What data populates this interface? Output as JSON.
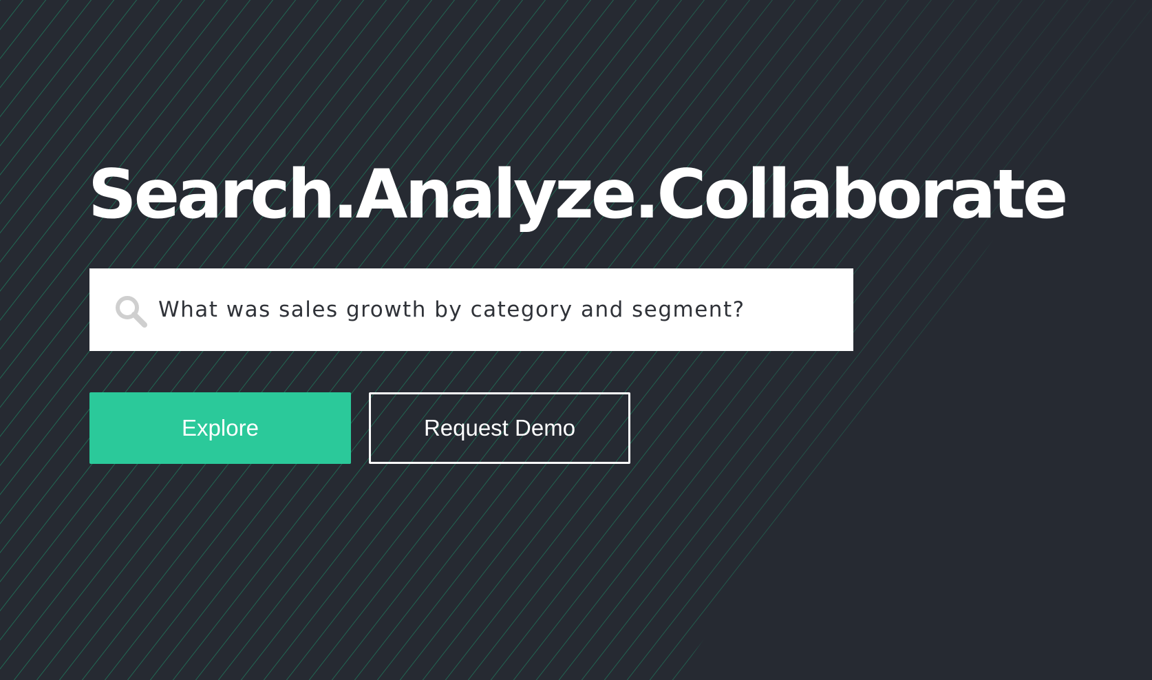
{
  "hero": {
    "headline": "Search.Analyze.Collaborate",
    "search": {
      "query": "What was sales growth by category and segment?",
      "icon": "search-icon"
    },
    "buttons": {
      "explore_label": "Explore",
      "demo_label": "Request Demo"
    }
  },
  "colors": {
    "background": "#262a32",
    "accent": "#2bc99a",
    "stripe": "#1f7a5c",
    "headline": "#ffffff",
    "search_text": "#2f3238",
    "search_icon": "#cfcfcf"
  }
}
